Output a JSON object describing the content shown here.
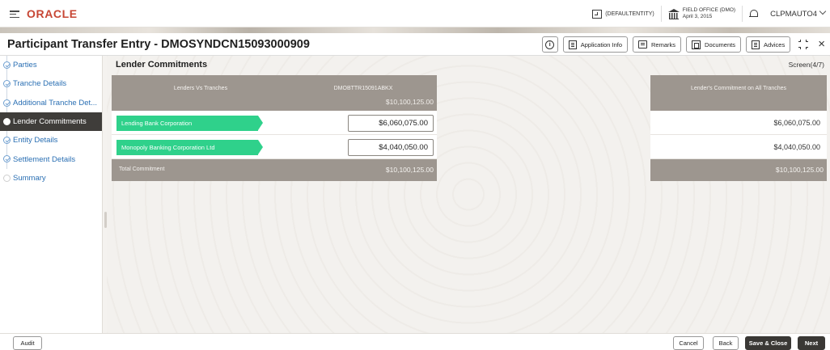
{
  "topbar": {
    "logo": "ORACLE",
    "entity": "(DEFAULTENTITY)",
    "office_name": "FIELD OFFICE (DMO)",
    "office_date": "April 3, 2015",
    "user": "CLPMAUTO4"
  },
  "header": {
    "title": "Participant Transfer Entry - DMOSYNDCN15093000909",
    "buttons": {
      "application_info": "Application Info",
      "remarks": "Remarks",
      "documents": "Documents",
      "advices": "Advices"
    }
  },
  "sidebar": {
    "items": [
      {
        "label": "Parties"
      },
      {
        "label": "Tranche Details"
      },
      {
        "label": "Additional Tranche Det..."
      },
      {
        "label": "Lender Commitments"
      },
      {
        "label": "Entity Details"
      },
      {
        "label": "Settlement Details"
      },
      {
        "label": "Summary"
      }
    ]
  },
  "main": {
    "section_title": "Lender Commitments",
    "screen": "Screen(4/7)",
    "table": {
      "col_lenders": "Lenders Vs Tranches",
      "col_tranche": "DMOBTTR15091ABKX",
      "tranche_total": "$10,100,125.00",
      "col_commitment": "Lender's Commitment on All Tranches",
      "rows": [
        {
          "lender": "Lending Bank Corporation",
          "amount": "$6,060,075.00",
          "commitment": "$6,060,075.00"
        },
        {
          "lender": "Monopoly Banking Corporation Ltd",
          "amount": "$4,040,050.00",
          "commitment": "$4,040,050.00"
        }
      ],
      "total_label": "Total Commitment",
      "total_tranche": "$10,100,125.00",
      "total_all": "$10,100,125.00"
    }
  },
  "footer": {
    "audit": "Audit",
    "cancel": "Cancel",
    "back": "Back",
    "save_close": "Save & Close",
    "next": "Next"
  },
  "colors": {
    "brand": "#c74634",
    "lender_tag": "#2fd18b",
    "header_gray": "#9d968f",
    "active_nav": "#3f3d3a",
    "link_blue": "#2a6fb3"
  }
}
